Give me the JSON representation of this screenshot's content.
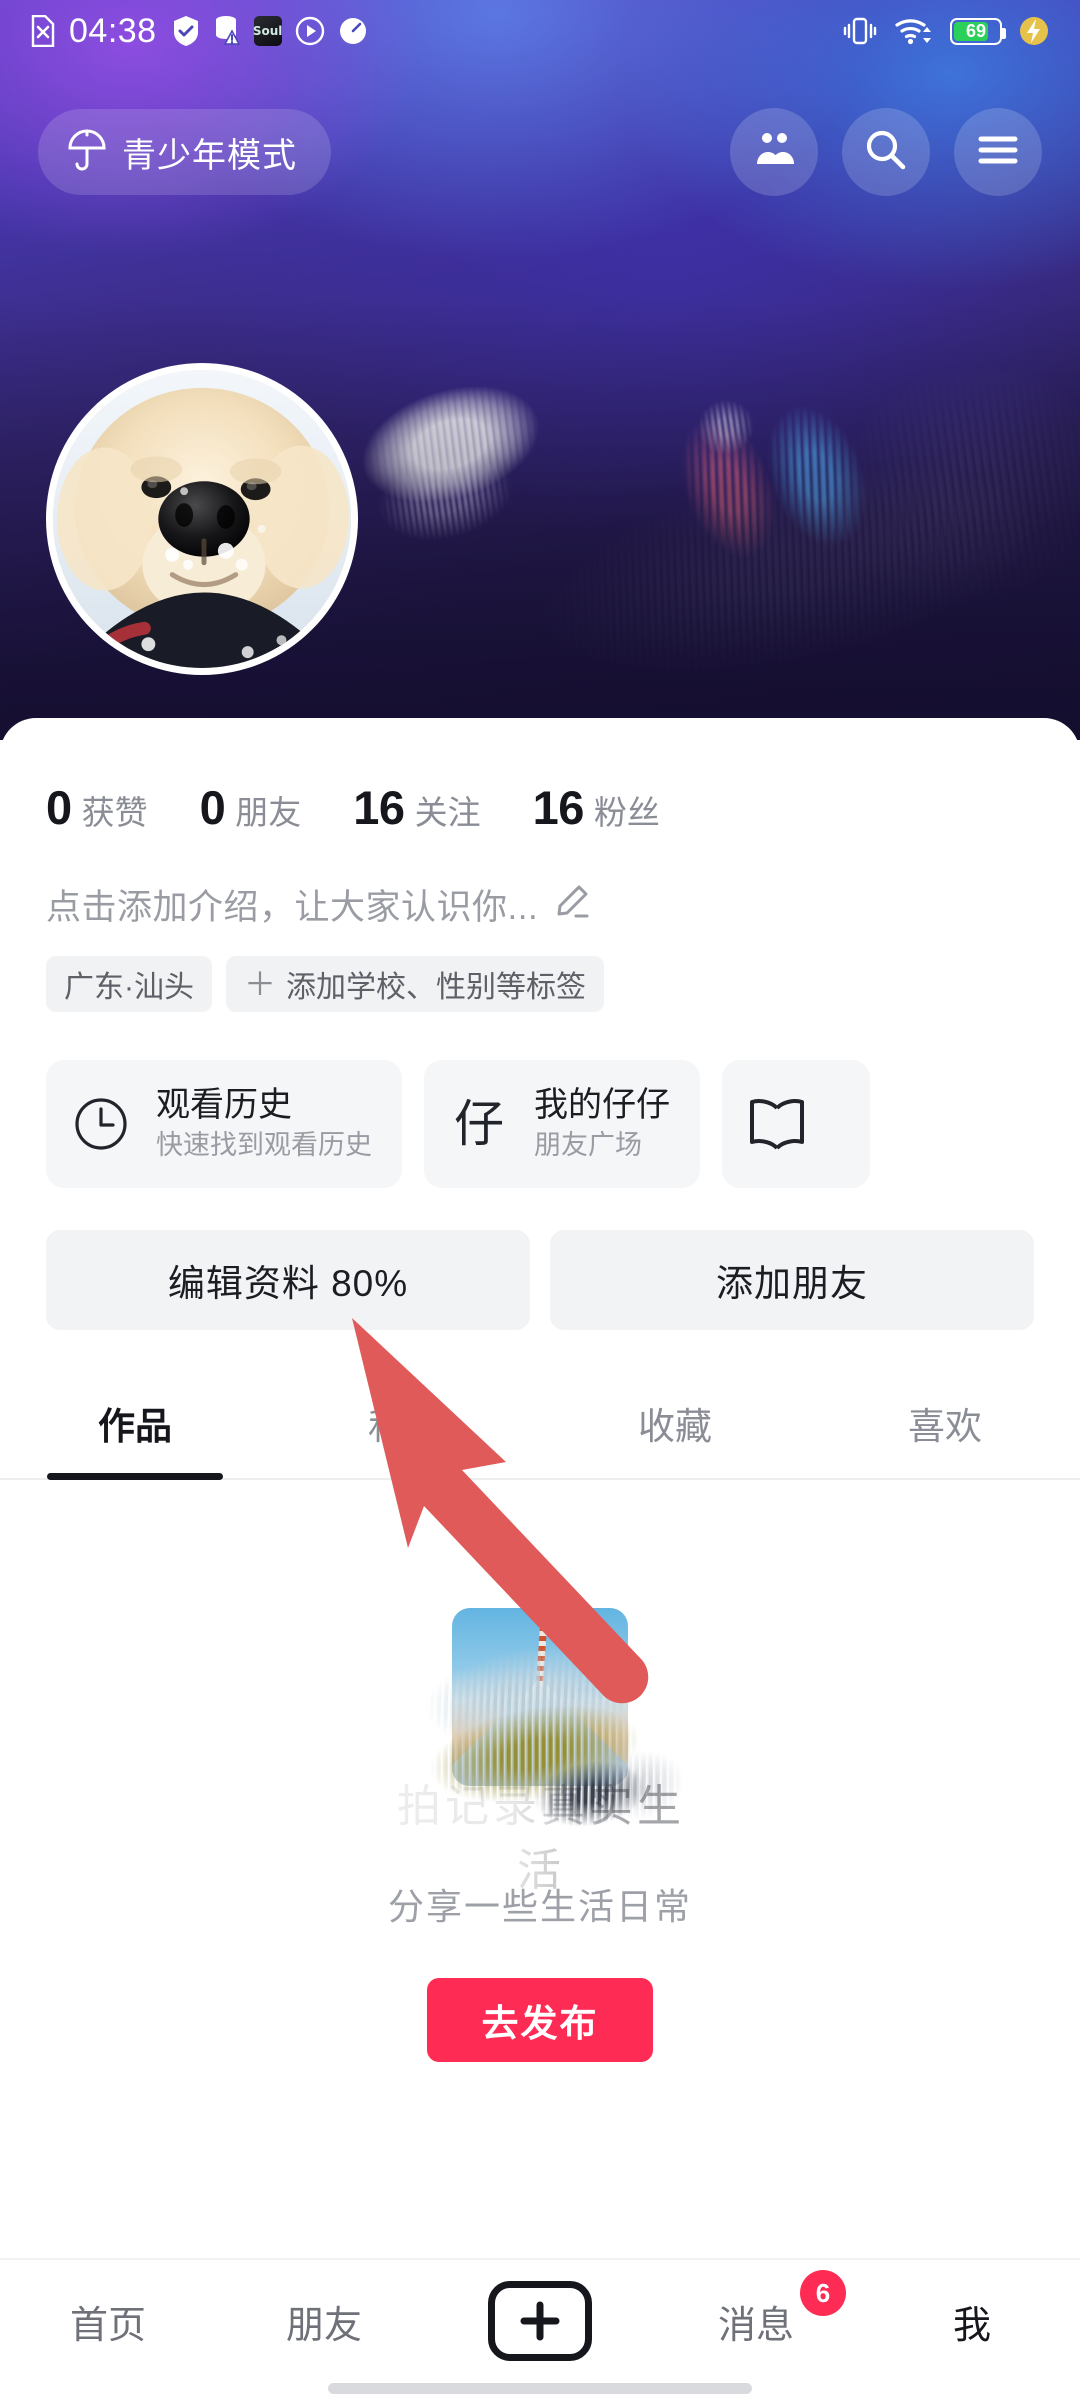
{
  "status_bar": {
    "time": "04:38",
    "left_icons": [
      "no-sim-icon",
      "shield-check-icon",
      "database-warning-icon",
      "soul-app-icon",
      "play-circle-icon",
      "speedometer-icon"
    ],
    "soul_label": "Soul",
    "right_icons": [
      "vibrate-icon",
      "wifi-icon",
      "battery-icon",
      "fast-charge-icon"
    ],
    "battery_percent": "69"
  },
  "top_bar": {
    "teen_mode_label": "青少年模式",
    "teen_mode_icon": "umbrella-icon",
    "actions": [
      {
        "name": "friends-icon"
      },
      {
        "name": "search-icon"
      },
      {
        "name": "menu-icon"
      }
    ]
  },
  "profile": {
    "avatar_alt": "golden-retriever-puppy-avatar",
    "stats": [
      {
        "value": "0",
        "label": "获赞"
      },
      {
        "value": "0",
        "label": "朋友"
      },
      {
        "value": "16",
        "label": "关注"
      },
      {
        "value": "16",
        "label": "粉丝"
      }
    ],
    "bio_placeholder": "点击添加介绍，让大家认识你...",
    "bio_edit_icon": "pencil-icon",
    "tags": [
      {
        "text": "广东·汕头",
        "has_plus": false
      },
      {
        "text": "添加学校、性别等标签",
        "has_plus": true,
        "plus": "＋"
      }
    ]
  },
  "cards": [
    {
      "icon": "clock-icon",
      "glyph": "",
      "title": "观看历史",
      "subtitle": "快速找到观看历史"
    },
    {
      "icon": "zaizai-icon",
      "glyph": "仔",
      "title": "我的仔仔",
      "subtitle": "朋友广场"
    },
    {
      "icon": "book-icon",
      "glyph": "",
      "title": "",
      "subtitle": ""
    }
  ],
  "actions": [
    {
      "label": "编辑资料 80%"
    },
    {
      "label": "添加朋友"
    }
  ],
  "tabs": [
    {
      "label": "作品",
      "active": true
    },
    {
      "label": "私密",
      "active": false
    },
    {
      "label": "收藏",
      "active": false
    },
    {
      "label": "喜欢",
      "active": false
    }
  ],
  "empty_state": {
    "artwork_text": "拍记录真实生活",
    "subtitle": "分享一些生活日常",
    "publish_label": "去发布"
  },
  "bottom_nav": [
    {
      "label": "首页",
      "active": false,
      "badge": null
    },
    {
      "label": "朋友",
      "active": false,
      "badge": null
    },
    {
      "label": "",
      "active": false,
      "badge": null,
      "icon": "plus-icon"
    },
    {
      "label": "消息",
      "active": false,
      "badge": "6"
    },
    {
      "label": "我",
      "active": true,
      "badge": null
    }
  ],
  "annotation": {
    "type": "arrow",
    "color": "#e05a5a",
    "points_to": "编辑资料 80%"
  },
  "colors": {
    "accent_red": "#fe2c55",
    "banner_purple": "#5b3fc4",
    "banner_blue": "#3c82e6",
    "text_primary": "#16171c",
    "text_secondary": "#8a8d96",
    "chip_bg": "#f2f3f5",
    "battery_green": "#2ad05a",
    "annotation_red": "#e05a5a"
  }
}
